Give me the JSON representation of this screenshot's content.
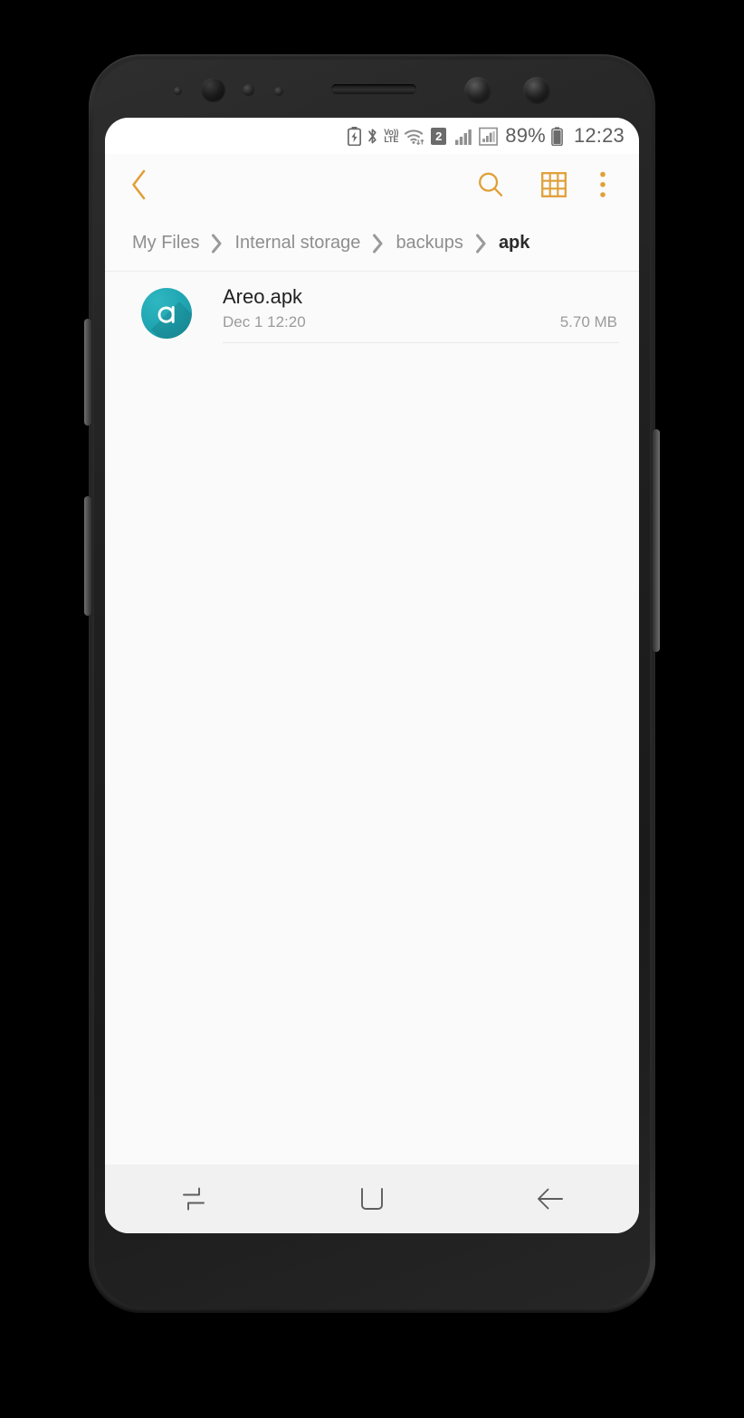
{
  "device": {
    "name": "samsung-galaxy-s8-mockup"
  },
  "status_bar": {
    "icons": [
      "battery-saver-icon",
      "bluetooth-icon",
      "volte-icon",
      "wifi-icon",
      "sim2-icon",
      "signal-bars-icon",
      "signal-box-icon"
    ],
    "volte_top": "Vo))",
    "volte_bottom": "LTE",
    "sim_label": "2",
    "battery_percent": "89%",
    "time": "12:23",
    "text_color": "#5e5e5e"
  },
  "toolbar": {
    "accent_color": "#e0a038",
    "back_label": "Back",
    "search_label": "Search",
    "grid_label": "Grid view",
    "more_label": "More options"
  },
  "breadcrumb": {
    "separator": "›",
    "items": [
      {
        "label": "My Files",
        "current": false
      },
      {
        "label": "Internal storage",
        "current": false
      },
      {
        "label": "backups",
        "current": false
      },
      {
        "label": "apk",
        "current": true
      }
    ]
  },
  "file_list": {
    "files": [
      {
        "name": "Areo.apk",
        "date": "Dec 1 12:20",
        "size": "5.70 MB",
        "icon": "areo-app-icon",
        "icon_color": "#21a8b4"
      }
    ]
  },
  "nav_bar": {
    "recents_label": "Recents",
    "home_label": "Home",
    "back_label": "Back"
  }
}
